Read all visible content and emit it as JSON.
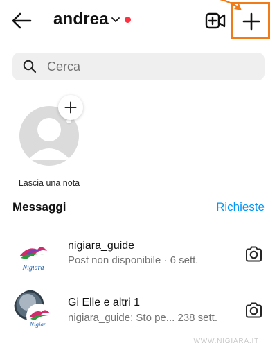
{
  "header": {
    "username": "andrea",
    "icons": {
      "back": "arrow-left-icon",
      "switch": "chevron-down-icon",
      "video": "new-video-chat-icon",
      "new_message": "plus-icon"
    },
    "unread_dot_color": "#ff3040",
    "highlight_color": "#f07c19"
  },
  "search": {
    "placeholder": "Cerca"
  },
  "note": {
    "label": "Lascia una nota"
  },
  "messages": {
    "title": "Messaggi",
    "requests_label": "Richieste",
    "accent_color": "#0095f6",
    "threads": [
      {
        "name": "nigiara_guide",
        "preview": "Post non disponibile · 6 sett.",
        "avatar_logo": "Nigiara"
      },
      {
        "name": "Gi Elle e altri 1",
        "preview": "nigiara_guide: Sto pe... 238 sett.",
        "avatar_logo": "Nigiara"
      }
    ]
  },
  "watermark": "WWW.NIGIARA.IT"
}
